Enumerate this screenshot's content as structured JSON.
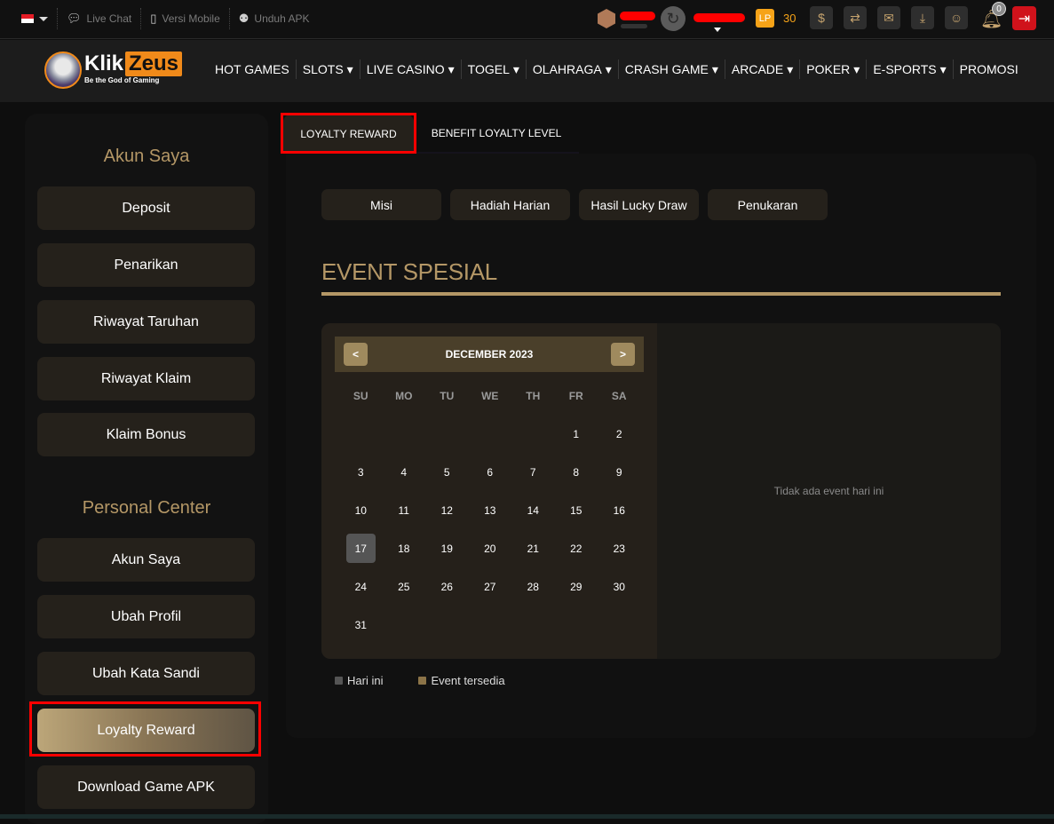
{
  "topbar": {
    "language_flag": "indonesia-flag",
    "links": [
      {
        "icon": "chat-bubble-icon",
        "label": "Live Chat"
      },
      {
        "icon": "mobile-phone-icon",
        "label": "Versi Mobile"
      },
      {
        "icon": "android-icon",
        "label": "Unduh APK"
      }
    ],
    "lp_badge": "LP",
    "lp_value": "30",
    "notification_count": "0",
    "tools": [
      "coin-exchange-icon",
      "transfer-icon",
      "mail-icon",
      "download-icon",
      "profile-icon"
    ]
  },
  "brand": {
    "name_part1": "Klik",
    "name_part2": "Zeus",
    "tagline": "Be the God of Gaming",
    "accent_color": "#f08a1a"
  },
  "nav": [
    {
      "label": "HOT GAMES",
      "dropdown": false
    },
    {
      "label": "SLOTS",
      "dropdown": true
    },
    {
      "label": "LIVE CASINO",
      "dropdown": true
    },
    {
      "label": "TOGEL",
      "dropdown": true
    },
    {
      "label": "OLAHRAGA",
      "dropdown": true
    },
    {
      "label": "CRASH GAME",
      "dropdown": true
    },
    {
      "label": "ARCADE",
      "dropdown": true
    },
    {
      "label": "POKER",
      "dropdown": true
    },
    {
      "label": "E-SPORTS",
      "dropdown": true
    },
    {
      "label": "PROMOSI",
      "dropdown": false
    }
  ],
  "sidebar": {
    "section1_title": "Akun Saya",
    "section1_items": [
      "Deposit",
      "Penarikan",
      "Riwayat Taruhan",
      "Riwayat Klaim",
      "Klaim Bonus"
    ],
    "section2_title": "Personal Center",
    "section2_items": [
      "Akun Saya",
      "Ubah Profil",
      "Ubah Kata Sandi",
      "Loyalty Reward",
      "Download Game APK"
    ],
    "active_item": "Loyalty Reward"
  },
  "main": {
    "tabs": [
      "LOYALTY REWARD",
      "BENEFIT LOYALTY LEVEL"
    ],
    "active_tab": "LOYALTY REWARD",
    "subtabs": [
      "Misi",
      "Hadiah Harian",
      "Hasil Lucky Draw",
      "Penukaran"
    ],
    "section_title": "EVENT SPESIAL",
    "calendar": {
      "prev_label": "<",
      "next_label": ">",
      "month_title": "DECEMBER 2023",
      "weekdays": [
        "SU",
        "MO",
        "TU",
        "WE",
        "TH",
        "FR",
        "SA"
      ],
      "weeks": [
        [
          "",
          "",
          "",
          "",
          "",
          "1",
          "2"
        ],
        [
          "3",
          "4",
          "5",
          "6",
          "7",
          "8",
          "9"
        ],
        [
          "10",
          "11",
          "12",
          "13",
          "14",
          "15",
          "16"
        ],
        [
          "17",
          "18",
          "19",
          "20",
          "21",
          "22",
          "23"
        ],
        [
          "24",
          "25",
          "26",
          "27",
          "28",
          "29",
          "30"
        ],
        [
          "31",
          "",
          "",
          "",
          "",
          "",
          ""
        ]
      ],
      "today": "17"
    },
    "empty_event_text": "Tidak ada event hari ini",
    "legend": [
      {
        "label": "Hari ini",
        "color": "#555555"
      },
      {
        "label": "Event tersedia",
        "color": "#8c7448"
      }
    ]
  }
}
